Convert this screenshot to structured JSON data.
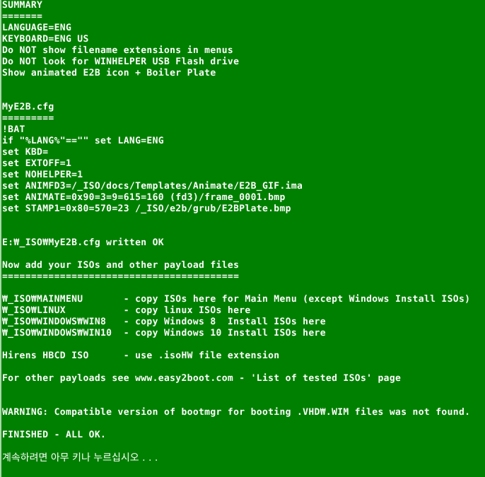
{
  "window": {
    "type": "console-window",
    "background_color": "#008000",
    "text_color": "#fdfdfd",
    "edge_color": "#a8d8a8",
    "codepage_note": "backslash renders as Won sign",
    "columns": 84,
    "rows": 42
  },
  "console": {
    "lines": [
      {
        "id": "summary-heading",
        "text": "SUMMARY"
      },
      {
        "id": "summary-underline",
        "text": "======="
      },
      {
        "id": "language-setting",
        "text": "LANGUAGE=ENG"
      },
      {
        "id": "keyboard-setting",
        "text": "KEYBOARD=ENG US"
      },
      {
        "id": "ext-setting",
        "text": "Do NOT show filename extensions in menus"
      },
      {
        "id": "winhelper-setting",
        "text": "Do NOT look for WINHELPER USB Flash drive"
      },
      {
        "id": "animation-setting",
        "text": "Show animated E2B icon + Boiler Plate"
      },
      {
        "id": "blank-1",
        "text": ""
      },
      {
        "id": "blank-2",
        "text": ""
      },
      {
        "id": "cfg-heading",
        "text": "MyE2B.cfg"
      },
      {
        "id": "cfg-underline",
        "text": "========="
      },
      {
        "id": "cfg-bat",
        "text": "!BAT"
      },
      {
        "id": "cfg-if-lang",
        "text": "if \"%LANG%\"==\"\" set LANG=ENG"
      },
      {
        "id": "cfg-set-kbd",
        "text": "set KBD="
      },
      {
        "id": "cfg-set-extoff",
        "text": "set EXTOFF=1"
      },
      {
        "id": "cfg-set-nohelper",
        "text": "set NOHELPER=1"
      },
      {
        "id": "cfg-set-animfd3",
        "text": "set ANIMFD3=/_ISO/docs/Templates/Animate/E2B_GIF.ima"
      },
      {
        "id": "cfg-set-animate",
        "text": "set ANIMATE=0x90=3=9=615=160 (fd3)/frame_0001.bmp"
      },
      {
        "id": "cfg-set-stamp1",
        "text": "set STAMP1=0x80=570=23 /_ISO/e2b/grub/E2BPlate.bmp"
      },
      {
        "id": "blank-3",
        "text": ""
      },
      {
        "id": "blank-4",
        "text": ""
      },
      {
        "id": "cfg-written-status",
        "text": "E:₩_ISO₩MyE2B.cfg written OK"
      },
      {
        "id": "blank-5",
        "text": ""
      },
      {
        "id": "add-isos-heading",
        "text": "Now add your ISOs and other payload files"
      },
      {
        "id": "add-isos-underline",
        "text": "========================================="
      },
      {
        "id": "blank-6",
        "text": ""
      },
      {
        "id": "folder-mainmenu",
        "text": "₩_ISO₩MAINMENU       - copy ISOs here for Main Menu (except Windows Install ISOs)"
      },
      {
        "id": "folder-linux",
        "text": "₩_ISO₩LINUX          - copy linux ISOs here"
      },
      {
        "id": "folder-win8",
        "text": "₩_ISO₩WINDOWS₩WIN8   - copy Windows 8  Install ISOs here"
      },
      {
        "id": "folder-win10",
        "text": "₩_ISO₩WINDOWS₩WIN10  - copy Windows 10 Install ISOs here"
      },
      {
        "id": "blank-7",
        "text": ""
      },
      {
        "id": "hirens-note",
        "text": "Hirens HBCD ISO      - use .isoHW file extension"
      },
      {
        "id": "blank-8",
        "text": ""
      },
      {
        "id": "other-payloads-note",
        "text": "For other payloads see www.easy2boot.com - 'List of tested ISOs' page"
      },
      {
        "id": "blank-9",
        "text": ""
      },
      {
        "id": "blank-10",
        "text": ""
      },
      {
        "id": "bootmgr-warning",
        "text": "WARNING: Compatible version of bootmgr for booting .VHD₩.WIM files was not found."
      },
      {
        "id": "blank-11",
        "text": ""
      },
      {
        "id": "finished-status",
        "text": "FINISHED - ALL OK."
      },
      {
        "id": "blank-12",
        "text": ""
      },
      {
        "id": "press-any-key-prompt",
        "text": "계속하려면 아무 키나 누르십시오 . . .",
        "korean": true
      }
    ]
  }
}
